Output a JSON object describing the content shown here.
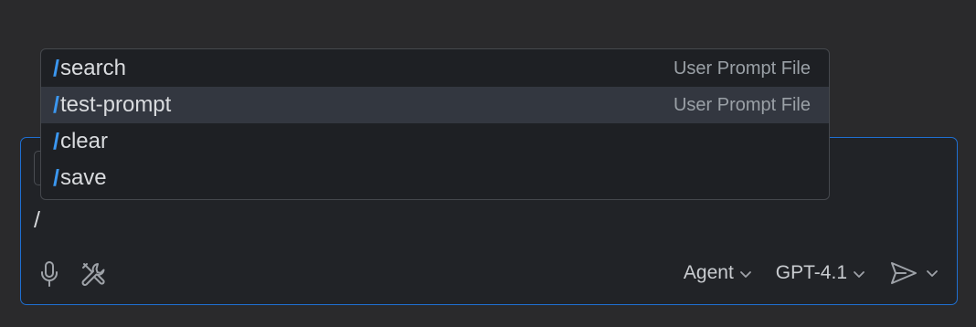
{
  "chat": {
    "input_value": "/",
    "mode_picker": "Agent",
    "model_picker": "GPT-4.1"
  },
  "suggestions": {
    "items": [
      {
        "slash": "/",
        "command": "search",
        "kind": "User Prompt File"
      },
      {
        "slash": "/",
        "command": "test-prompt",
        "kind": "User Prompt File"
      },
      {
        "slash": "/",
        "command": "clear",
        "kind": ""
      },
      {
        "slash": "/",
        "command": "save",
        "kind": ""
      }
    ]
  },
  "colors": {
    "focus_border": "#1f6fd1",
    "slash_accent": "#3b97f0",
    "selected_row": "#333740"
  },
  "icons": {
    "voice": "microphone-icon",
    "tools": "tools-icon",
    "send": "send-icon",
    "chevron": "chevron-down-icon"
  }
}
